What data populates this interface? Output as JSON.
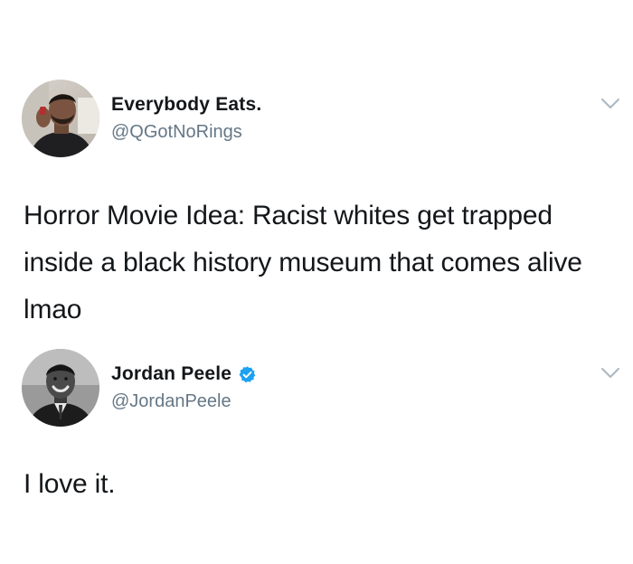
{
  "tweets": [
    {
      "display_name": "Everybody Eats.",
      "handle": "@QGotNoRings",
      "verified": false,
      "text": "Horror Movie Idea: Racist whites get trapped inside a black history museum that comes alive lmao",
      "avatar_icon": "profile-photo-man-with-beard",
      "menu_icon": "chevron-down-icon"
    },
    {
      "display_name": "Jordan Peele",
      "handle": "@JordanPeele",
      "verified": true,
      "text": "I love it.",
      "avatar_icon": "profile-photo-bw-man-in-suit",
      "menu_icon": "chevron-down-icon"
    }
  ],
  "colors": {
    "text": "#14171a",
    "handle": "#657786",
    "verified_badge": "#1da1f2",
    "chevron": "#aab8c2"
  }
}
